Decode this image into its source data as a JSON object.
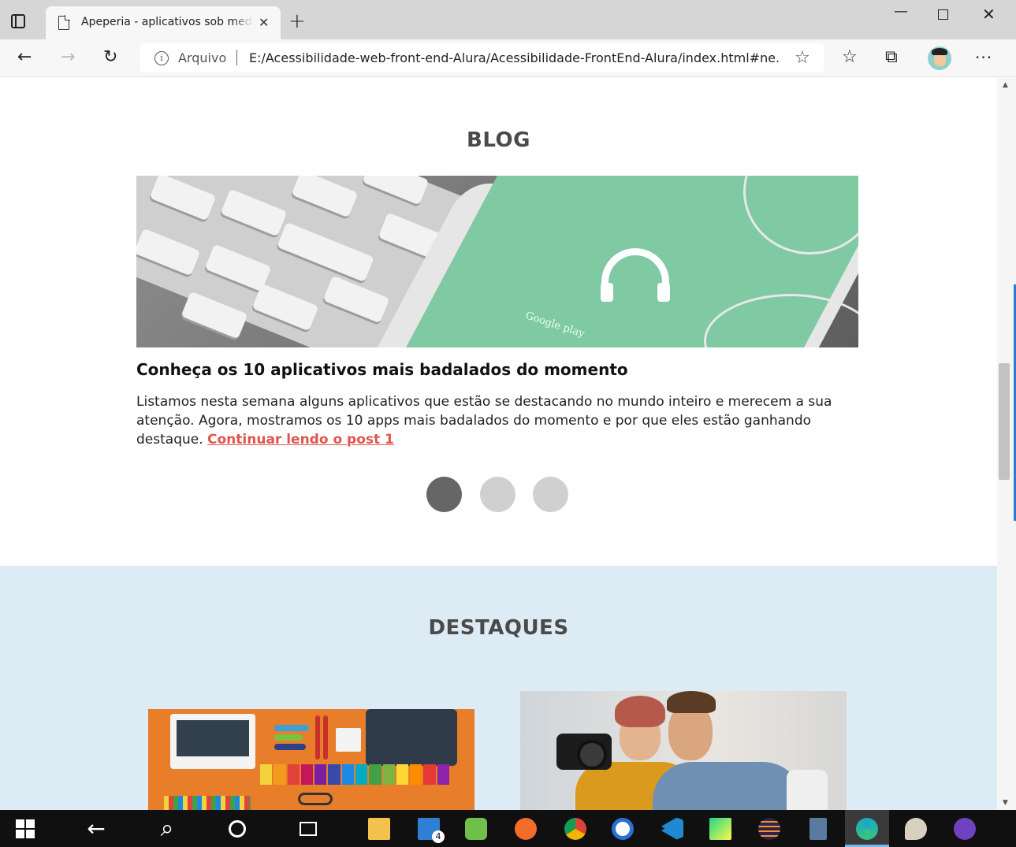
{
  "browser": {
    "tab": {
      "title": "Apeperia - aplicativos sob medida",
      "close": "✕"
    },
    "new_tab": "+",
    "window": {
      "minimize": "—",
      "close": "✕"
    },
    "nav": {
      "back": "←",
      "forward": "→",
      "reload": "↻"
    },
    "address": {
      "site_label": "Arquivo",
      "url": "E:/Acessibilidade-web-front-end-Alura/Acessibilidade-FrontEnd-Alura/index.html#ne..."
    },
    "icons": {
      "favorite_add": "☆",
      "favorites": "☆",
      "collections": "⧉",
      "more": "···"
    }
  },
  "blog": {
    "heading": "BLOG",
    "image": {
      "text": "Google play"
    },
    "post": {
      "title": "Conheça os 10 aplicativos mais badalados do momento",
      "body": "Listamos nesta semana alguns aplicativos que estão se destacando no mundo inteiro e merecem a sua atenção. Agora, mostramos os 10 apps mais badalados do momento e por que eles estão ganhando destaque. ",
      "link": "Continuar lendo o post 1"
    },
    "carousel": {
      "active_index": 1,
      "count": 3
    }
  },
  "highlights": {
    "heading": "DESTAQUES"
  },
  "scrollbar": {
    "up": "▲",
    "down": "▼"
  },
  "taskbar": {
    "back": "←",
    "search": "⌕",
    "mail_badge": "4",
    "colors": {
      "explorer": "#f2c14e",
      "mail": "#2f7fd6",
      "notepad": "#6fbf4a",
      "brave": "#f26c2a",
      "chrome": "#db4437",
      "word": "#2b6fd6",
      "vscode": "#1f8ad2",
      "pycharm": "#21d789",
      "eclipse": "#2c2255",
      "calculator": "#5b7aa0",
      "edge": "#1aa7c9",
      "paint": "#d9d1c0",
      "github": "#6f42c1"
    }
  },
  "colors": {
    "accent_link": "#e0554f",
    "highlights_bg": "#dcebf4",
    "dot_active": "#666666",
    "dot_inactive": "#d0d0d0"
  }
}
